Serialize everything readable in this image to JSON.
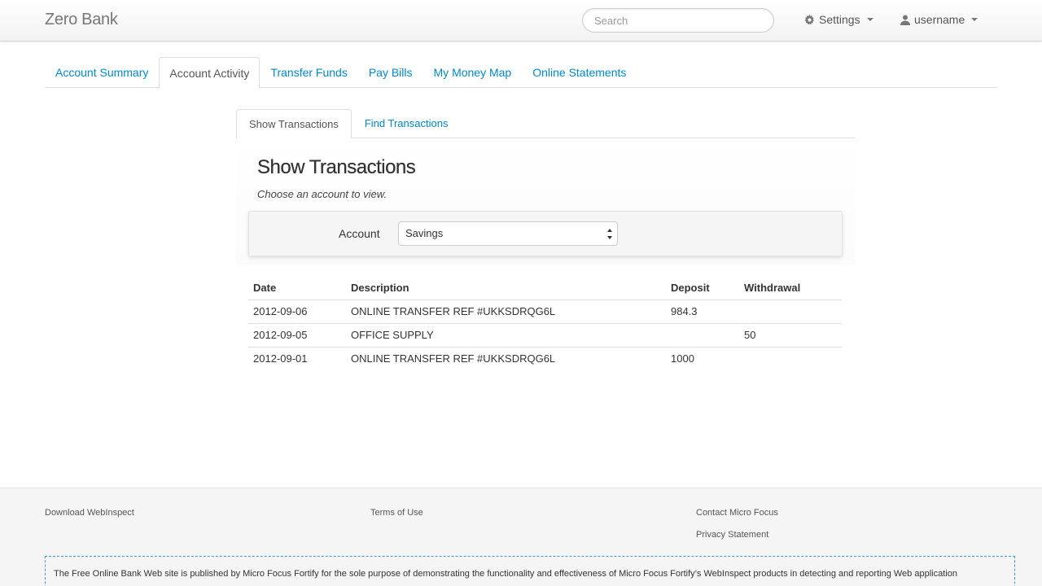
{
  "header": {
    "brand": "Zero Bank",
    "search_placeholder": "Search",
    "settings_label": "Settings",
    "user_label": "username"
  },
  "main_tabs": [
    {
      "label": "Account Summary",
      "active": false
    },
    {
      "label": "Account Activity",
      "active": true
    },
    {
      "label": "Transfer Funds",
      "active": false
    },
    {
      "label": "Pay Bills",
      "active": false
    },
    {
      "label": "My Money Map",
      "active": false
    },
    {
      "label": "Online Statements",
      "active": false
    }
  ],
  "sub_tabs": [
    {
      "label": "Show Transactions",
      "active": true
    },
    {
      "label": "Find Transactions",
      "active": false
    }
  ],
  "content": {
    "title": "Show Transactions",
    "subtitle": "Choose an account to view.",
    "account_label": "Account",
    "account_selected": "Savings"
  },
  "table": {
    "headers": [
      "Date",
      "Description",
      "Deposit",
      "Withdrawal"
    ],
    "rows": [
      {
        "date": "2012-09-06",
        "description": "ONLINE TRANSFER REF #UKKSDRQG6L",
        "deposit": "984.3",
        "withdrawal": ""
      },
      {
        "date": "2012-09-05",
        "description": "OFFICE SUPPLY",
        "deposit": "",
        "withdrawal": "50"
      },
      {
        "date": "2012-09-01",
        "description": "ONLINE TRANSFER REF #UKKSDRQG6L",
        "deposit": "1000",
        "withdrawal": ""
      }
    ]
  },
  "footer": {
    "download": "Download WebInspect",
    "terms": "Terms of Use",
    "contact": "Contact Micro Focus",
    "privacy": "Privacy Statement",
    "disclaimer": "The Free Online Bank Web site is published by Micro Focus Fortify for the sole purpose of demonstrating the functionality and effectiveness of Micro Focus Fortify’s WebInspect products in detecting and reporting Web application"
  },
  "colors": {
    "link": "#0088cc",
    "disclaimer_border": "#3a9ad9"
  }
}
